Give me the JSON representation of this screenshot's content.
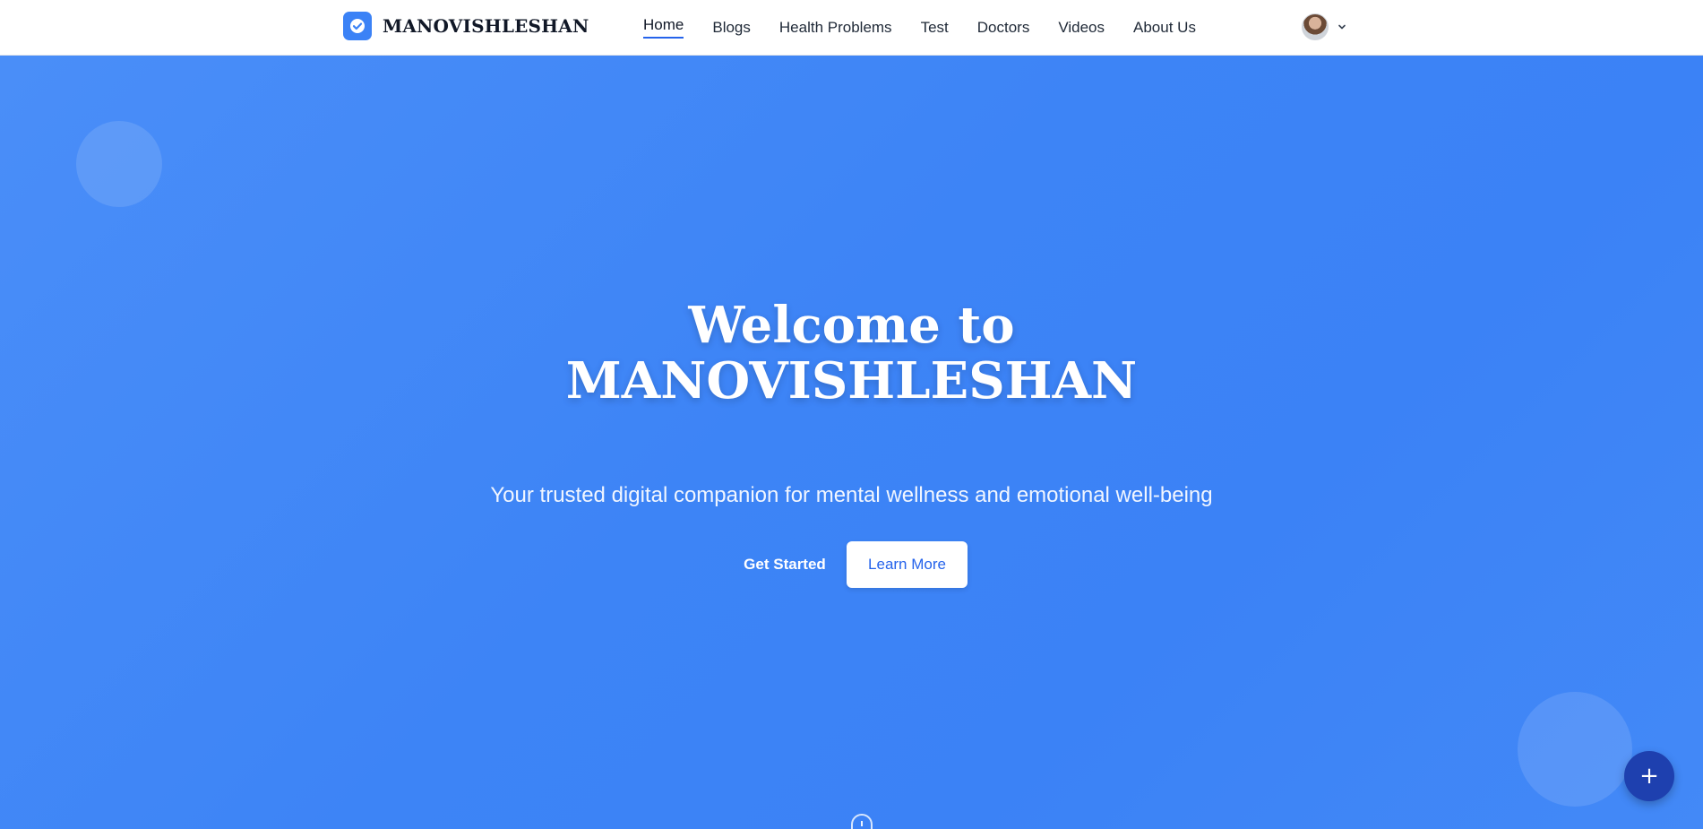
{
  "header": {
    "brand_name": "MANOVISHLESHAN",
    "brand_icon": "check-circle-icon",
    "nav": [
      {
        "label": "Home",
        "active": true
      },
      {
        "label": "Blogs",
        "active": false
      },
      {
        "label": "Health Problems",
        "active": false
      },
      {
        "label": "Test",
        "active": false
      },
      {
        "label": "Doctors",
        "active": false
      },
      {
        "label": "Videos",
        "active": false
      },
      {
        "label": "About Us",
        "active": false
      }
    ],
    "user_menu_icon": "chevron-down-icon"
  },
  "hero": {
    "title_line1": "Welcome to",
    "title_line2": "MANOVISHLESHAN",
    "subtitle": "Your trusted digital companion for mental wellness and emotional well-being",
    "primary_button": "Get Started",
    "secondary_button": "Learn More"
  },
  "fab": {
    "label": "+",
    "icon": "plus-icon"
  },
  "colors": {
    "brand": "#3b82f6",
    "hero_background": "#3d84f6",
    "fab": "#1e40af",
    "active_underline": "#2563eb"
  }
}
